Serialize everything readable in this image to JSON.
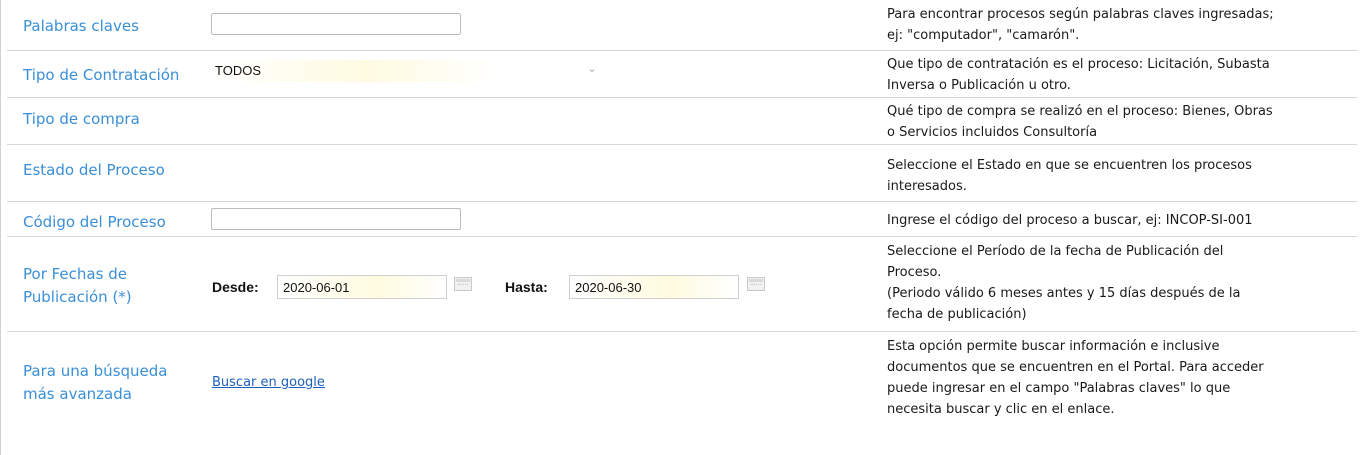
{
  "rows": {
    "keywords": {
      "label": "Palabras claves",
      "value": "",
      "help_line1": "Para encontrar procesos según palabras claves ingresadas;",
      "help_line2": "ej: \"computador\", \"camarón\"."
    },
    "contract_type": {
      "label": "Tipo de Contratación",
      "selected": "TODOS",
      "help_line1": "Que tipo de contratación es el proceso: Licitación, Subasta",
      "help_line2": "Inversa o Publicación u otro."
    },
    "purchase_type": {
      "label": "Tipo de compra",
      "help_line1": "Qué tipo de compra se realizó en el proceso: Bienes, Obras",
      "help_line2": "o Servicios incluidos Consultoría"
    },
    "status": {
      "label": "Estado del Proceso",
      "help_line1": "Seleccione el Estado en que se encuentren los procesos",
      "help_line2": "interesados."
    },
    "code": {
      "label": "Código del Proceso",
      "value": "",
      "help_line1": "Ingrese el código del proceso a buscar, ej: INCOP-SI-001"
    },
    "dates": {
      "label_line1": "Por Fechas de",
      "label_line2": "Publicación (*)",
      "from_label": "Desde:",
      "from_value": "2020-06-01",
      "to_label": "Hasta:",
      "to_value": "2020-06-30",
      "help_line1": "Seleccione el Período de la fecha de Publicación del",
      "help_line2": "Proceso.",
      "help_line3": "(Periodo válido 6 meses antes y 15 días después de la",
      "help_line4": "fecha de publicación)"
    },
    "advanced": {
      "label_line1": "Para una búsqueda",
      "label_line2": "más avanzada",
      "link_text": "Buscar en google",
      "help_line1": "Esta opción permite buscar información e inclusive",
      "help_line2": "documentos que se encuentren en el Portal. Para acceder",
      "help_line3": "puede ingresar en el campo \"Palabras claves\" lo que",
      "help_line4": "necesita buscar y clic en el enlace."
    }
  },
  "icons": {
    "select_chevron": "chevron-down-icon",
    "date_picker": "calendar-icon"
  },
  "colors": {
    "label_blue": "#3a8fd6",
    "link_blue": "#1d5fbf",
    "divider": "#d6d6d6"
  }
}
